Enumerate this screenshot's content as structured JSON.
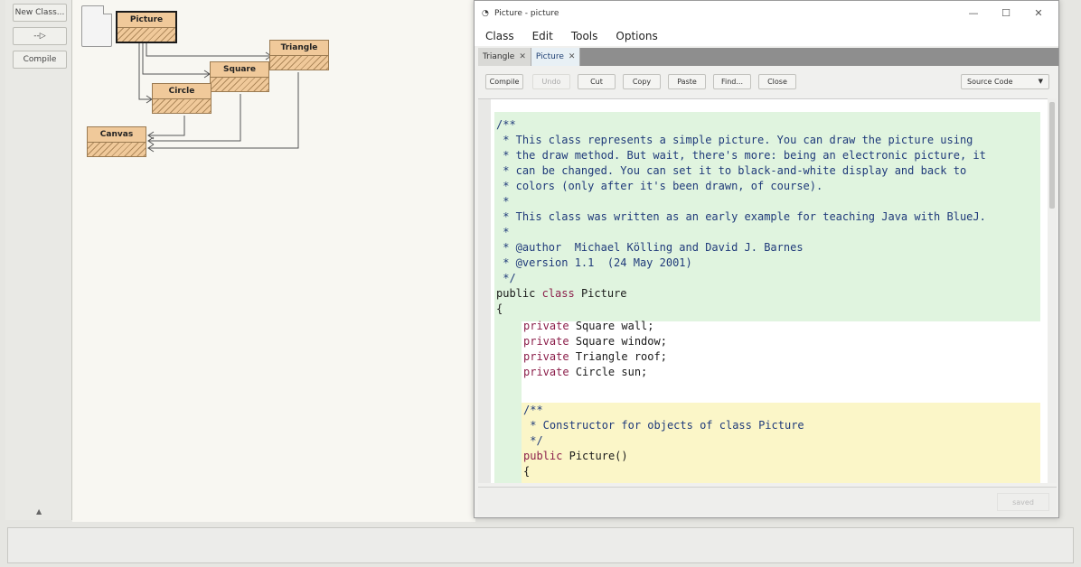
{
  "left_toolbar": {
    "new_class": "New Class...",
    "arrow": "--▷",
    "compile": "Compile",
    "collapse": "▲"
  },
  "diagram": {
    "classes": {
      "picture": "Picture",
      "triangle": "Triangle",
      "square": "Square",
      "circle": "Circle",
      "canvas": "Canvas"
    }
  },
  "editor": {
    "title": "Picture - picture",
    "window_controls": {
      "minimize": "—",
      "maximize": "☐",
      "close": "✕"
    },
    "menu": [
      "Class",
      "Edit",
      "Tools",
      "Options"
    ],
    "tabs": [
      {
        "label": "Triangle",
        "close": "✕"
      },
      {
        "label": "Picture",
        "close": "✕"
      }
    ],
    "toolbar": {
      "compile": "Compile",
      "undo": "Undo",
      "cut": "Cut",
      "copy": "Copy",
      "paste": "Paste",
      "find": "Find...",
      "close": "Close",
      "view": "Source Code",
      "view_arrow": "▼"
    },
    "saved": "saved",
    "code": {
      "l1": "/**",
      "l2": " * This class represents a simple picture. You can draw the picture using",
      "l3": " * the draw method. But wait, there's more: being an electronic picture, it",
      "l4": " * can be changed. You can set it to black-and-white display and back to",
      "l5": " * colors (only after it's been drawn, of course).",
      "l6": " *",
      "l7": " * This class was written as an early example for teaching Java with BlueJ.",
      "l8": " *",
      "l9": " * @author  Michael Kölling and David J. Barnes",
      "l10": " * @version 1.1  (24 May 2001)",
      "l11": " */",
      "kw_public": "public",
      "kw_class": "class",
      "class_name": "Picture",
      "brace_open": "{",
      "kw_private": "private",
      "f1": "Square wall;",
      "f2": "Square window;",
      "f3": "Triangle roof;",
      "f4": "Circle sun;",
      "c1": "/**",
      "c2": " * Constructor for objects of class Picture",
      "c3": " */",
      "ctor_sig": "Picture()",
      "ctor_brace": "{"
    }
  }
}
